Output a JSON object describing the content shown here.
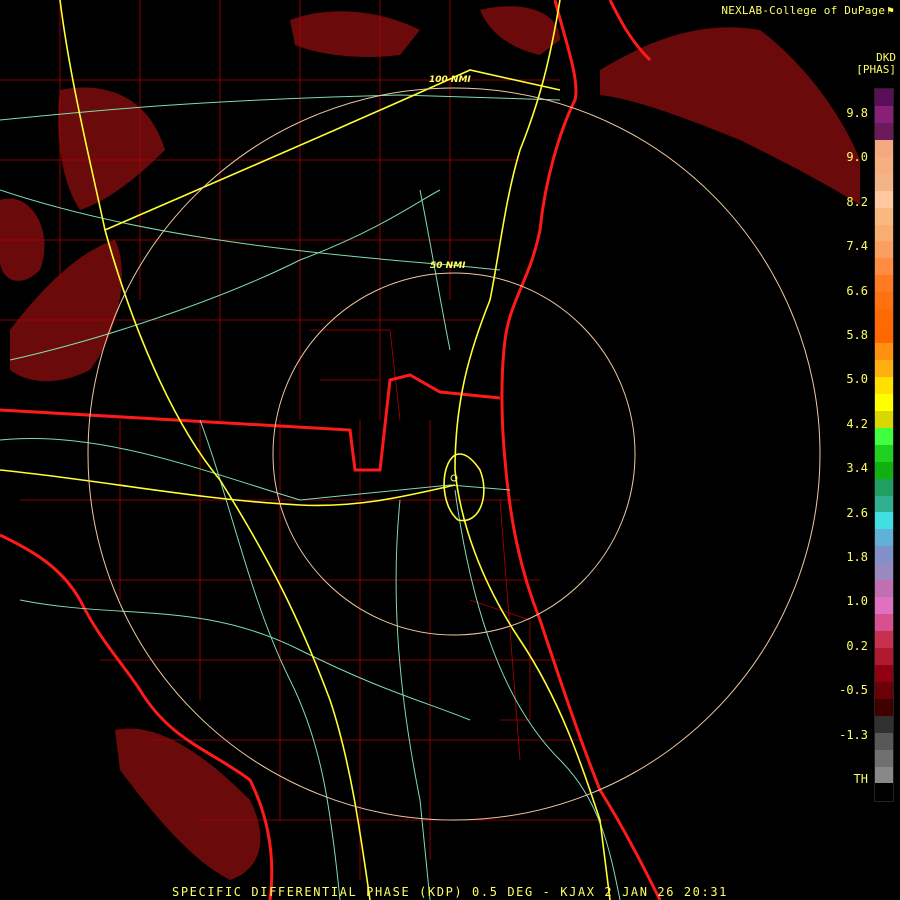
{
  "header": {
    "credit": "NEXLAB-College of DuPage",
    "credit_icon": "logo-flag-icon",
    "product_code": "DKD",
    "product_unit": "[PHAS]"
  },
  "map": {
    "radar_site": "KJAX",
    "range_rings": [
      {
        "range_nmi": 50,
        "label": "50 NMI"
      },
      {
        "range_nmi": 100,
        "label": "100 NMI"
      }
    ],
    "colors": {
      "state_borders": "#ff1a1a",
      "county_lines": "#b00000",
      "interstates": "#ffff33",
      "highways": "#7fdcb0",
      "range_rings": "#f0c8a0",
      "echo": "#6a0a0a",
      "background": "#000000"
    }
  },
  "legend": {
    "ticks": [
      "9.8",
      "9.0",
      "8.2",
      "7.4",
      "6.6",
      "5.8",
      "5.0",
      "4.2",
      "3.4",
      "2.6",
      "1.8",
      "1.0",
      "0.2",
      "-0.5",
      "-1.3",
      "TH"
    ],
    "colors": [
      "#5a0e5a",
      "#8a1f7a",
      "#6a1a5a",
      "#f4a880",
      "#f6b080",
      "#f4b488",
      "#ffc8a0",
      "#f9b880",
      "#f7ae70",
      "#f9a060",
      "#ff8c40",
      "#ff7a20",
      "#ff7010",
      "#ff6a00",
      "#ff6800",
      "#ff9010",
      "#ffb010",
      "#ffe000",
      "#ffff00",
      "#d8d800",
      "#40ff40",
      "#20d020",
      "#10b010",
      "#20a060",
      "#30b090",
      "#40e0e0",
      "#60b0d8",
      "#8090c8",
      "#9a88c0",
      "#c070b0",
      "#e070c0",
      "#d85090",
      "#c83050",
      "#b01830",
      "#900010",
      "#6a0008",
      "#400000",
      "#303030",
      "#585858",
      "#707070",
      "#888888",
      "#000000"
    ]
  },
  "footer": {
    "caption": "SPECIFIC DIFFERENTIAL PHASE (KDP) 0.5 DEG - KJAX 2 JAN 26 20:31"
  }
}
